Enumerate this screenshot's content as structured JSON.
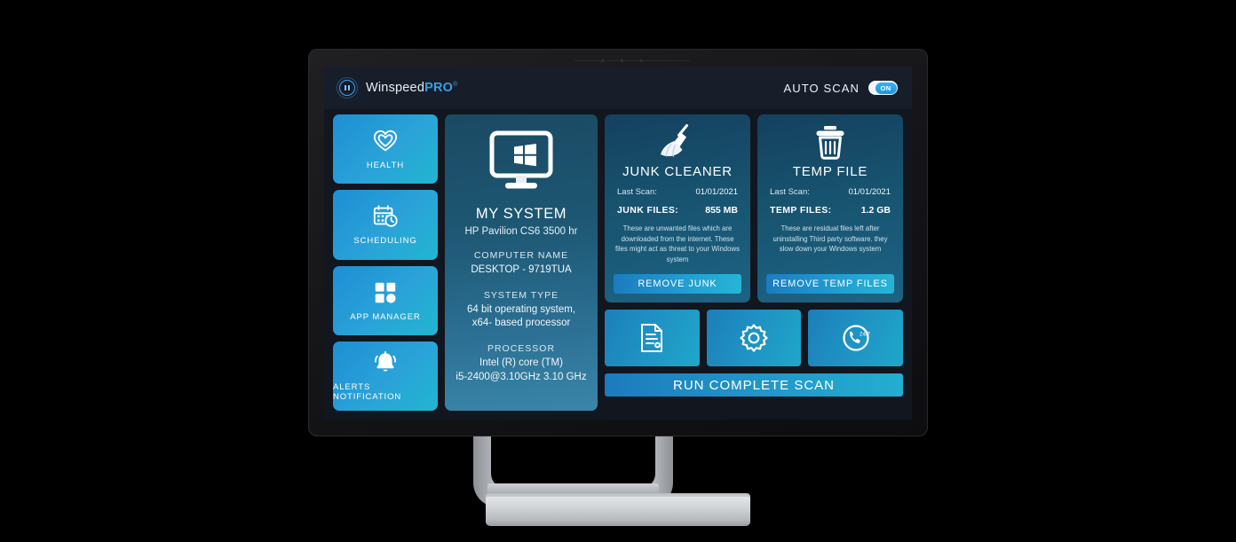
{
  "app": {
    "brand_name": "Winspeed",
    "brand_suffix": "PRO",
    "brand_reg": "®",
    "autoscan_label": "AUTO SCAN",
    "autoscan_state": "ON",
    "accent": "#21a0d2",
    "screen_bg": "#12161f",
    "header_bg": "#181d2a"
  },
  "sidebar": {
    "items": [
      {
        "label": "HEALTH",
        "icon": "heart-icon"
      },
      {
        "label": "SCHEDULING",
        "icon": "calendar-clock-icon"
      },
      {
        "label": "APP MANAGER",
        "icon": "grid-apps-icon"
      },
      {
        "label": "ALERTS NOTIFICATION",
        "icon": "bell-icon"
      }
    ]
  },
  "system": {
    "icon": "windows-monitor-icon",
    "title": "MY SYSTEM",
    "model": "HP Pavilion CS6 3500 hr",
    "groups": [
      {
        "key": "COMPUTER NAME",
        "value": "DESKTOP - 9719TUA"
      },
      {
        "key": "SYSTEM TYPE",
        "value": "64 bit operating system,\nx64- based processor"
      },
      {
        "key": "PROCESSOR",
        "value": "Intel (R) core (TM)\ni5-2400@3.10GHz 3.10 GHz"
      }
    ]
  },
  "cards": [
    {
      "id": "junk-cleaner",
      "icon": "broom-icon",
      "title": "JUNK CLEANER",
      "last_scan_label": "Last Scan:",
      "last_scan_value": "01/01/2021",
      "files_label": "JUNK FILES:",
      "files_value": "855 MB",
      "description": "These are unwanted files which are downloaded from the internet. These files might act as threat to your Windows system",
      "button": "REMOVE JUNK"
    },
    {
      "id": "temp-file",
      "icon": "trash-icon",
      "title": "TEMP FILE",
      "last_scan_label": "Last Scan:",
      "last_scan_value": "01/01/2021",
      "files_label": "TEMP FILES:",
      "files_value": "1.2 GB",
      "description": "These are residual files left after uninstalling Third party software. they slow down your Windows system",
      "button": "REMOVE TEMP FILES"
    }
  ],
  "tiles": [
    {
      "id": "report",
      "icon": "document-report-icon"
    },
    {
      "id": "settings",
      "icon": "gear-icon"
    },
    {
      "id": "support",
      "icon": "support-247-icon"
    }
  ],
  "scan": {
    "label": "RUN COMPLETE SCAN"
  }
}
